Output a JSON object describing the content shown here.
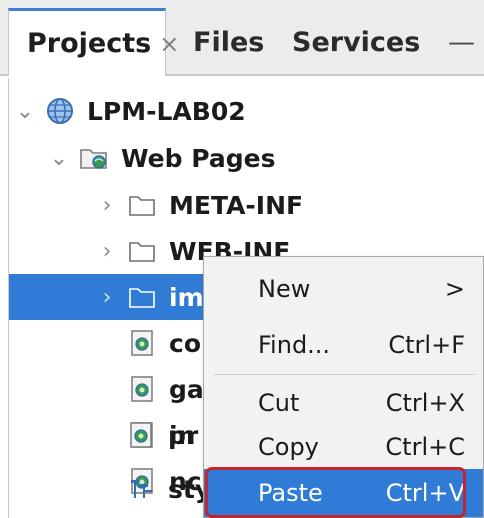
{
  "tabs": {
    "projects": "Projects",
    "projects_close": "×",
    "files": "Files",
    "services": "Services",
    "minimize": "—"
  },
  "tree": {
    "root": "LPM-LAB02",
    "web_pages": "Web Pages",
    "meta_inf": "META-INF",
    "web_inf": "WEB-INF",
    "img": "img",
    "f1": "co",
    "f2": "ga",
    "f3": "in",
    "f4": "nc",
    "f5": "pr",
    "f6": "sty"
  },
  "context_menu": {
    "new": "New",
    "new_arrow": ">",
    "find": "Find...",
    "find_shortcut": "Ctrl+F",
    "cut": "Cut",
    "cut_shortcut": "Ctrl+X",
    "copy": "Copy",
    "copy_shortcut": "Ctrl+C",
    "paste": "Paste",
    "paste_shortcut": "Ctrl+V",
    "highlight_color": "#2f7bd6",
    "outline_color": "#c1272d"
  }
}
